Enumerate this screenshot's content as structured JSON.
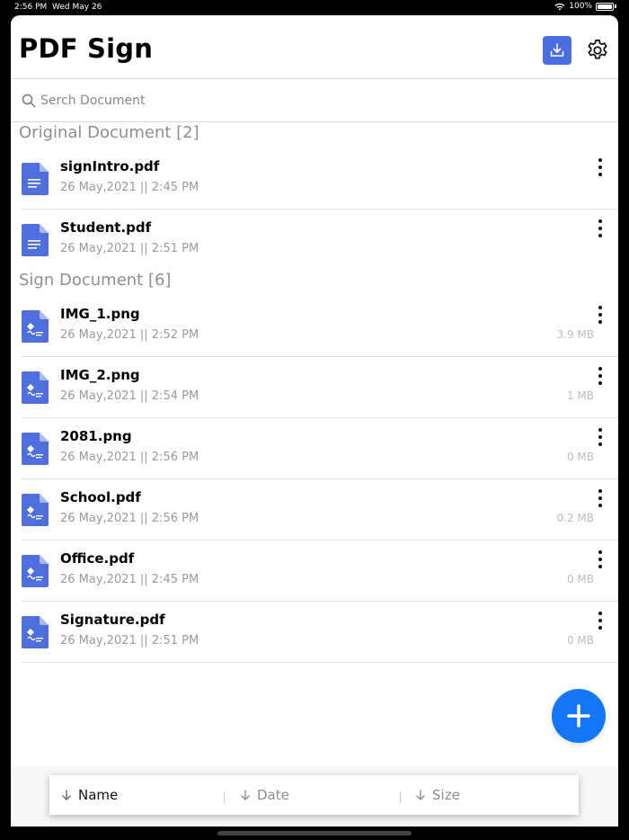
{
  "status_bar": {
    "time": "2:56 PM",
    "date": "Wed May 26",
    "battery": "100%"
  },
  "header": {
    "title": "PDF Sign",
    "download_icon": "download-icon",
    "settings_icon": "gear-icon"
  },
  "search": {
    "placeholder": "Serch Document",
    "value": ""
  },
  "original_section": {
    "title": "Original Document [2]",
    "items": [
      {
        "name": "signIntro.pdf",
        "date": "26 May,2021 || 2:45 PM",
        "size": "",
        "icon": "document-icon"
      },
      {
        "name": "Student.pdf",
        "date": "26 May,2021 || 2:51 PM",
        "size": "",
        "icon": "document-icon"
      }
    ]
  },
  "sign_section": {
    "title": "Sign Document [6]",
    "items": [
      {
        "name": "IMG_1.png",
        "date": "26 May,2021 || 2:52 PM",
        "size": "3.9 MB",
        "icon": "signed-document-icon"
      },
      {
        "name": "IMG_2.png",
        "date": "26 May,2021 || 2:54 PM",
        "size": "1 MB",
        "icon": "signed-document-icon"
      },
      {
        "name": "2081.png",
        "date": "26 May,2021 || 2:56 PM",
        "size": "0 MB",
        "icon": "signed-document-icon"
      },
      {
        "name": "School.pdf",
        "date": "26 May,2021 || 2:56 PM",
        "size": "0.2 MB",
        "icon": "signed-document-icon"
      },
      {
        "name": "Office.pdf",
        "date": "26 May,2021 || 2:45 PM",
        "size": "0 MB",
        "icon": "signed-document-icon"
      },
      {
        "name": "Signature.pdf",
        "date": "26 May,2021 || 2:51 PM",
        "size": "0 MB",
        "icon": "signed-document-icon"
      }
    ]
  },
  "sort_bar": {
    "name_label": "Name",
    "date_label": "Date",
    "size_label": "Size",
    "active": "Name"
  },
  "colors": {
    "accent": "#4a6ee0",
    "fab": "#1476f5",
    "muted": "#8e8e8e"
  }
}
